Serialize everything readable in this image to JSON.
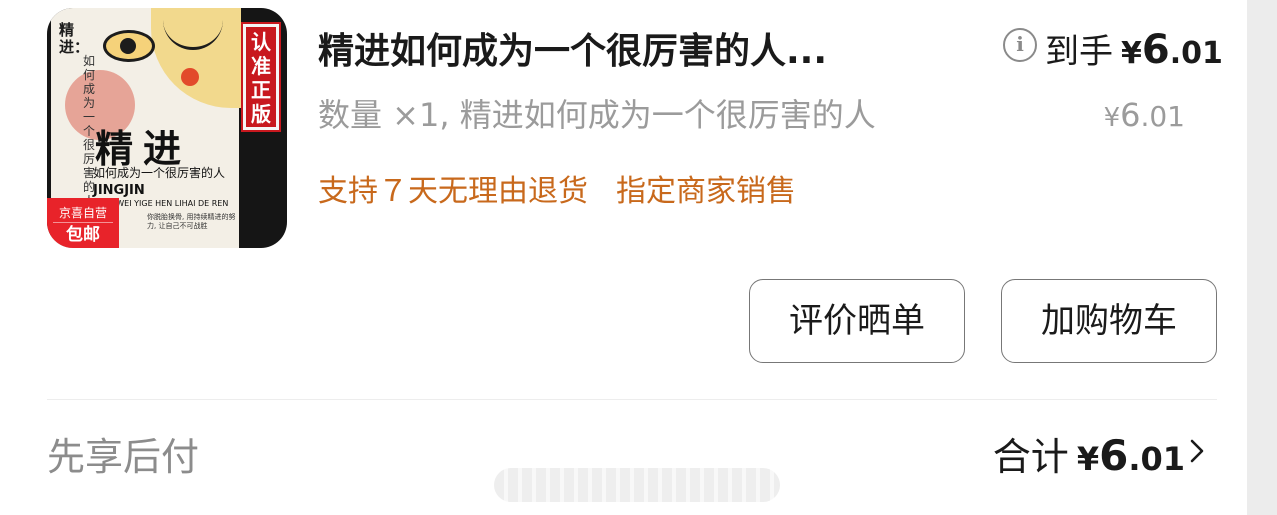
{
  "product": {
    "thumbnail": {
      "vertical_title": "精进：",
      "vertical_subtitle": "如何成为一个很厉害的人",
      "cover_title": "精进",
      "cover_subtitle": "如何成为一个很厉害的人",
      "cover_en_title": "JINGJIN",
      "cover_en_subtitle": "HENGWEI YIGE HEN LIHAI DE REN",
      "cover_blurb": "你脱胎换骨, 用持续精进的努力, 让自己不可战胜",
      "badge_authentic": "认准正版",
      "tag_jd_self": "京喜自营",
      "tag_free_shipping": "包邮"
    },
    "title": "精进如何成为一个很厉害的人...",
    "final_price": {
      "label": "到手",
      "currency": "¥",
      "integer": "6",
      "decimal": ".01"
    },
    "spec": "数量 ×1, 精进如何成为一个很厉害的人",
    "unit_price": {
      "currency": "¥",
      "integer": "6",
      "decimal": ".01"
    },
    "service_tags": [
      "支持７天无理由退货",
      "指定商家销售"
    ]
  },
  "actions": {
    "review_label": "评价晒单",
    "cart_label": "加购物车"
  },
  "footer": {
    "pay_later": "先享后付",
    "total_label": "合计",
    "total_currency": "¥",
    "total_integer": "6",
    "total_decimal": ".01"
  },
  "colors": {
    "accent_tag": "#c8691c",
    "muted_text": "#9b9b9b",
    "badge_red": "#c8181e",
    "jd_red": "#e8232a"
  },
  "icons": {
    "info": "info-icon",
    "chevron": "chevron-right-icon"
  }
}
